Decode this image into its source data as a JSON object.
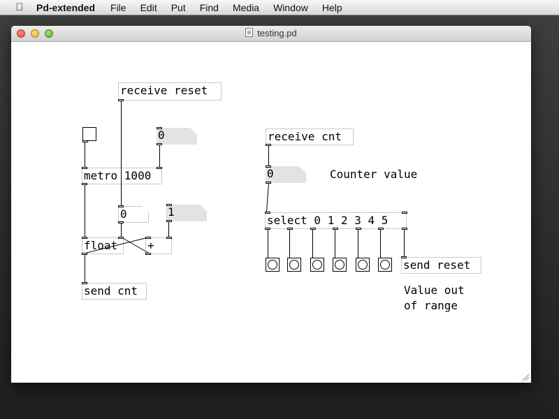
{
  "menubar": {
    "app_name": "Pd-extended",
    "items": [
      "File",
      "Edit",
      "Put",
      "Find",
      "Media",
      "Window",
      "Help"
    ]
  },
  "window": {
    "title": "testing.pd"
  },
  "patch": {
    "receive_reset": "receive reset",
    "number_top": "0",
    "metro": "metro 1000",
    "number_counter": "0",
    "number_one": "1",
    "float": "float",
    "plus": "+",
    "send_cnt": "send cnt",
    "receive_cnt": "receive cnt",
    "number_cnt": "0",
    "comment_counter": "Counter value",
    "select": "select 0 1 2 3 4 5",
    "send_reset": "send reset",
    "comment_range": "Value out\nof range"
  }
}
